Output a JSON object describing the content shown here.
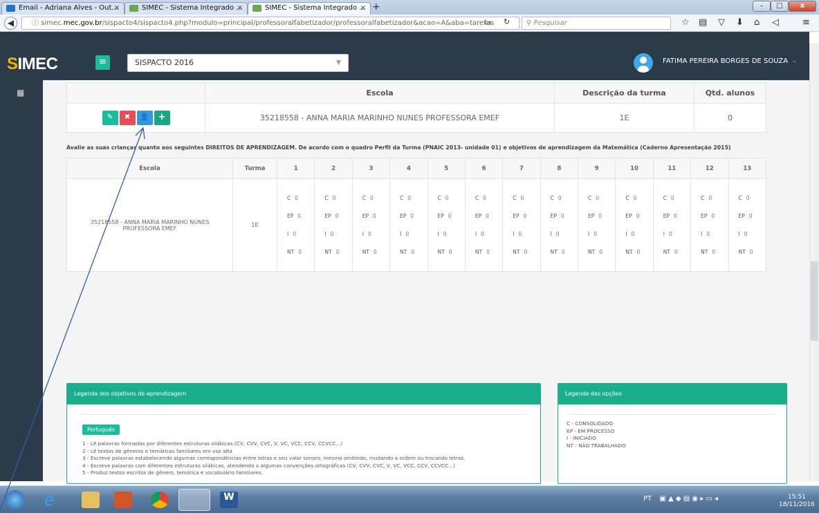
{
  "browser": {
    "tabs": [
      {
        "label": "Email - Adriana Alves - Out..."
      },
      {
        "label": "SIMEC - Sistema Integrado ..."
      },
      {
        "label": "SIMEC - Sistema Integrado ..."
      }
    ],
    "url_domain": "simec.mec.gov.br",
    "url_path": "/sispacto4/sispacto4.php?modulo=principal/professoralfabetizador/professoralfabetizador&acao=A&aba=tarefas",
    "url_prefix": "simec.",
    "url_domain_bold": "mec.gov.br",
    "search_placeholder": "Pesquisar"
  },
  "app": {
    "brand_prefix": "S",
    "brand_suffix": "IMEC",
    "program": "SISPACTO 2016",
    "user_name": "FATIMA PEREIRA BORGES DE SOUZA"
  },
  "table1": {
    "headers": [
      "",
      "Escola",
      "Descrição da turma",
      "Qtd. alunos"
    ],
    "row": {
      "escola": "35218558 - ANNA MARIA MARINHO NUNES PROFESSORA EMEF",
      "turma": "1E",
      "qtd": "0"
    }
  },
  "instruction": "Avalie as suas crianças quanto aos seguintes DIREITOS DE APRENDIZAGEM. De acordo com o quadro Perfil da Turma (PNAIC 2013- unidade 01) e objetivos de aprendizagem da Matemática (Caderno Apresentação 2015)",
  "table2": {
    "headers": [
      "Escola",
      "Turma",
      "1",
      "2",
      "3",
      "4",
      "5",
      "6",
      "7",
      "8",
      "9",
      "10",
      "11",
      "12",
      "13"
    ],
    "row": {
      "escola": "35218558 - ANNA MARIA MARINHO NUNES PROFESSORA EMEF",
      "turma": "1E"
    },
    "criteria": [
      {
        "code": "C",
        "value": "0"
      },
      {
        "code": "EP",
        "value": "0"
      },
      {
        "code": "I",
        "value": "0"
      },
      {
        "code": "NT",
        "value": "0"
      }
    ]
  },
  "legend_objectives": {
    "title": "Legenda dos objetivos de aprendizagem",
    "subject": "Português",
    "items": [
      "1 - Lê palavras formadas por diferentes estruturas silábicas.(CV, CVV, CVC, V, VC, VCC, CCV, CCVCC...)",
      "2 - Lê textos de gêneros e temáticas familiares em voz alta",
      "3 - Escreve palavras estabelecendo algumas correspondências entre letras e seu valor sonoro, mesmo omitindo, mudando a ordem ou trocando letras.",
      "4 - Escreve palavras com diferentes estruturas silábicas, atendendo a algumas convenções ortográficas (CV, CVV, CVC, V, VC, VCC, CCV, CCVCC...)",
      "5 - Produz textos escritos de gênero, temática e vocabulário familiares."
    ]
  },
  "legend_options": {
    "title": "Legenda das opções",
    "items": [
      "C - CONSOLIDADO",
      "EP - EM PROCESSO",
      "I - INICIADO",
      "NT - NÃO TRABALHADO"
    ]
  },
  "taskbar": {
    "language": "PT",
    "time": "15:51",
    "date": "18/11/2016"
  },
  "colors": {
    "accent": "#1abc9c",
    "header": "#2b3b4a",
    "btn_edit": "#1abc9c",
    "btn_delete": "#e74c5a",
    "btn_user": "#3498db",
    "btn_add": "#1aa784"
  }
}
